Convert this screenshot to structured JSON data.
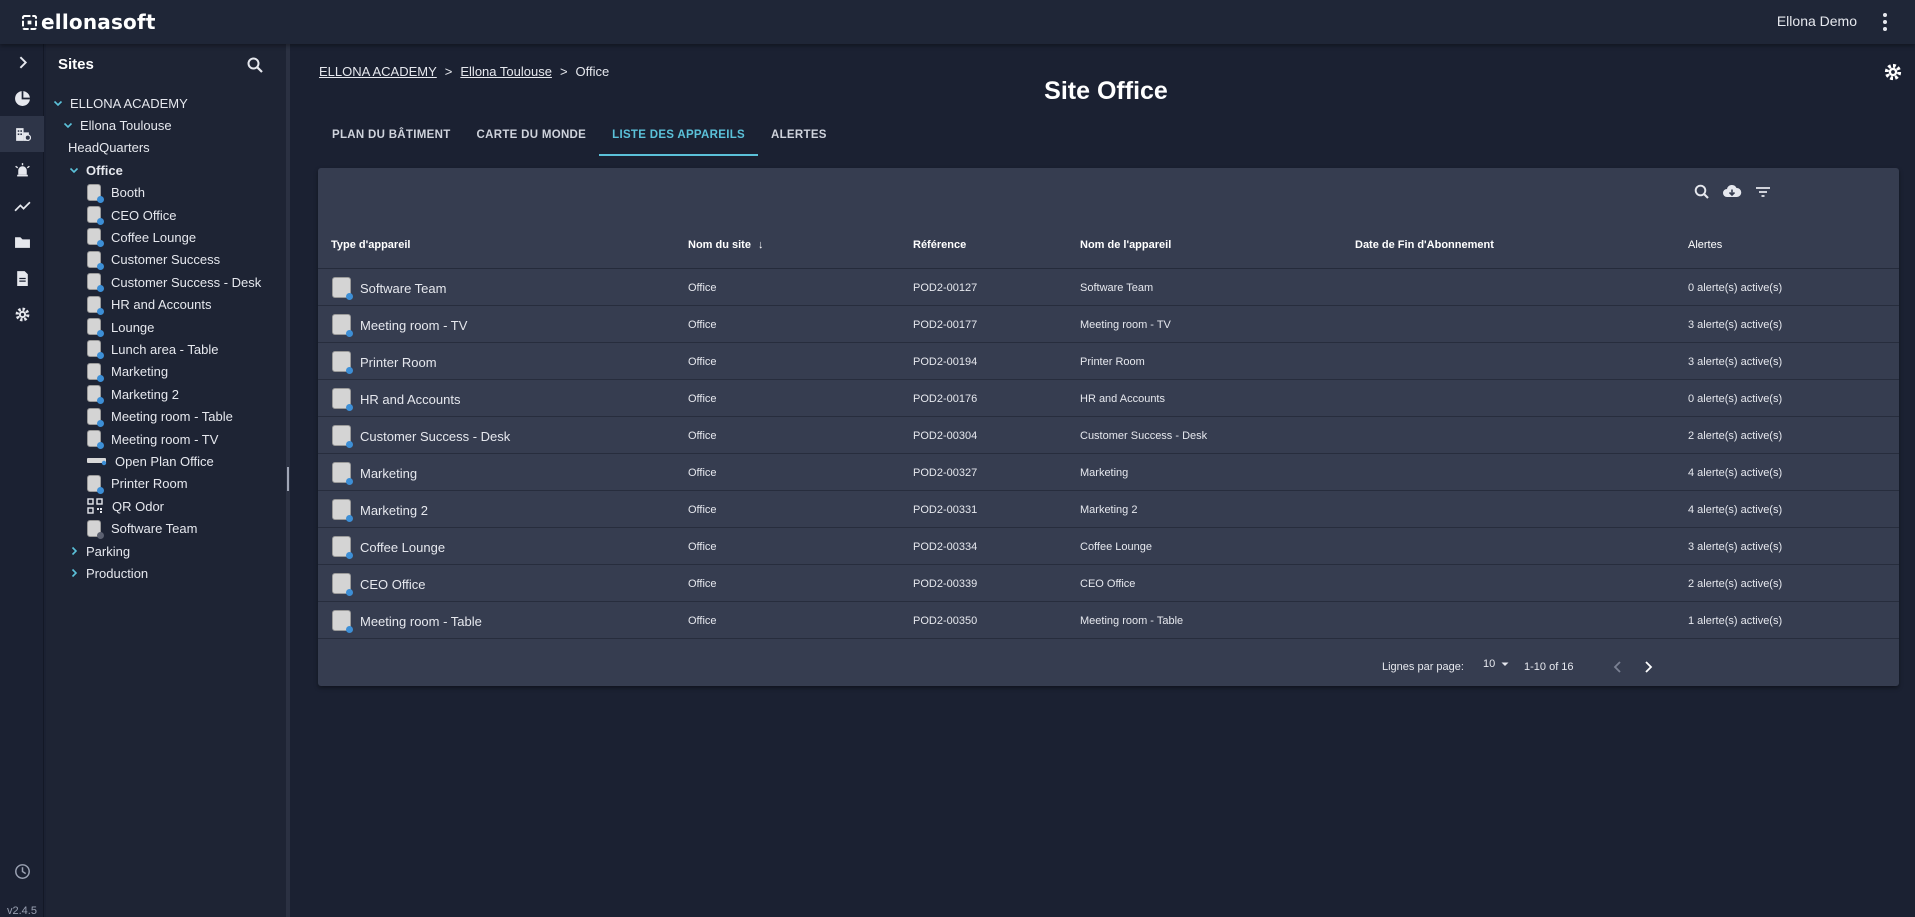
{
  "header": {
    "brand": "ellonasoft",
    "user": "Ellona Demo"
  },
  "rail": {
    "icons": [
      "expand-icon",
      "dashboard-icon",
      "buildings-icon",
      "alarm-icon",
      "trend-icon",
      "folder-icon",
      "document-icon",
      "settings-icon",
      "history-icon"
    ],
    "version": "v2.4.5"
  },
  "sites": {
    "title": "Sites",
    "tree": [
      {
        "label": "ELLONA ACADEMY",
        "level": 0,
        "caret": "down"
      },
      {
        "label": "Ellona Toulouse",
        "level": 1,
        "caret": "down"
      },
      {
        "label": "HeadQuarters",
        "level": 2,
        "caret": "none"
      },
      {
        "label": "Office",
        "level": 2,
        "caret": "down",
        "bold": true
      },
      {
        "label": "Booth",
        "level": 3,
        "icon": "device"
      },
      {
        "label": "CEO Office",
        "level": 3,
        "icon": "device"
      },
      {
        "label": "Coffee Lounge",
        "level": 3,
        "icon": "device"
      },
      {
        "label": "Customer Success",
        "level": 3,
        "icon": "device"
      },
      {
        "label": "Customer Success - Desk",
        "level": 3,
        "icon": "device"
      },
      {
        "label": "HR and Accounts",
        "level": 3,
        "icon": "device"
      },
      {
        "label": "Lounge",
        "level": 3,
        "icon": "device"
      },
      {
        "label": "Lunch area - Table",
        "level": 3,
        "icon": "device"
      },
      {
        "label": "Marketing",
        "level": 3,
        "icon": "device"
      },
      {
        "label": "Marketing 2",
        "level": 3,
        "icon": "device"
      },
      {
        "label": "Meeting room - Table",
        "level": 3,
        "icon": "device"
      },
      {
        "label": "Meeting room - TV",
        "level": 3,
        "icon": "device"
      },
      {
        "label": "Open Plan Office",
        "level": 3,
        "icon": "bar"
      },
      {
        "label": "Printer Room",
        "level": 3,
        "icon": "device"
      },
      {
        "label": "QR Odor",
        "level": 3,
        "icon": "qr"
      },
      {
        "label": "Software Team",
        "level": 3,
        "icon": "device-grey"
      },
      {
        "label": "Parking",
        "level": 2,
        "caret": "right"
      },
      {
        "label": "Production",
        "level": 2,
        "caret": "right"
      }
    ]
  },
  "main": {
    "breadcrumb": {
      "root": "ELLONA ACADEMY",
      "sep": ">",
      "site": "Ellona Toulouse",
      "current": "Office"
    },
    "title": "Site Office",
    "tabs": [
      {
        "label": "PLAN DU BÂTIMENT",
        "active": false
      },
      {
        "label": "CARTE DU MONDE",
        "active": false
      },
      {
        "label": "LISTE DES APPAREILS",
        "active": true
      },
      {
        "label": "ALERTES",
        "active": false
      }
    ],
    "accent": "#5bc1d9"
  },
  "table": {
    "columns": {
      "type": "Type d'appareil",
      "site": "Nom du site",
      "ref": "Référence",
      "name": "Nom de l'appareil",
      "end": "Date de Fin d'Abonnement",
      "alerts": "Alertes"
    },
    "sort_indicator": "↓",
    "rows": [
      {
        "type": "Software Team",
        "site": "Office",
        "ref": "POD2-00127",
        "name": "Software Team",
        "end": "",
        "alerts": "0 alerte(s) active(s)"
      },
      {
        "type": "Meeting room - TV",
        "site": "Office",
        "ref": "POD2-00177",
        "name": "Meeting room - TV",
        "end": "",
        "alerts": "3 alerte(s) active(s)"
      },
      {
        "type": "Printer Room",
        "site": "Office",
        "ref": "POD2-00194",
        "name": "Printer Room",
        "end": "",
        "alerts": "3 alerte(s) active(s)"
      },
      {
        "type": "HR and Accounts",
        "site": "Office",
        "ref": "POD2-00176",
        "name": "HR and Accounts",
        "end": "",
        "alerts": "0 alerte(s) active(s)"
      },
      {
        "type": "Customer Success - Desk",
        "site": "Office",
        "ref": "POD2-00304",
        "name": "Customer Success - Desk",
        "end": "",
        "alerts": "2 alerte(s) active(s)"
      },
      {
        "type": "Marketing",
        "site": "Office",
        "ref": "POD2-00327",
        "name": "Marketing",
        "end": "",
        "alerts": "4 alerte(s) active(s)"
      },
      {
        "type": "Marketing 2",
        "site": "Office",
        "ref": "POD2-00331",
        "name": "Marketing 2",
        "end": "",
        "alerts": "4 alerte(s) active(s)"
      },
      {
        "type": "Coffee Lounge",
        "site": "Office",
        "ref": "POD2-00334",
        "name": "Coffee Lounge",
        "end": "",
        "alerts": "3 alerte(s) active(s)"
      },
      {
        "type": "CEO Office",
        "site": "Office",
        "ref": "POD2-00339",
        "name": "CEO Office",
        "end": "",
        "alerts": "2 alerte(s) active(s)"
      },
      {
        "type": "Meeting room - Table",
        "site": "Office",
        "ref": "POD2-00350",
        "name": "Meeting room - Table",
        "end": "",
        "alerts": "1 alerte(s) active(s)"
      }
    ],
    "footer": {
      "rows_label": "Lignes par page:",
      "rows_value": "10",
      "range": "1-10 of 16"
    }
  }
}
